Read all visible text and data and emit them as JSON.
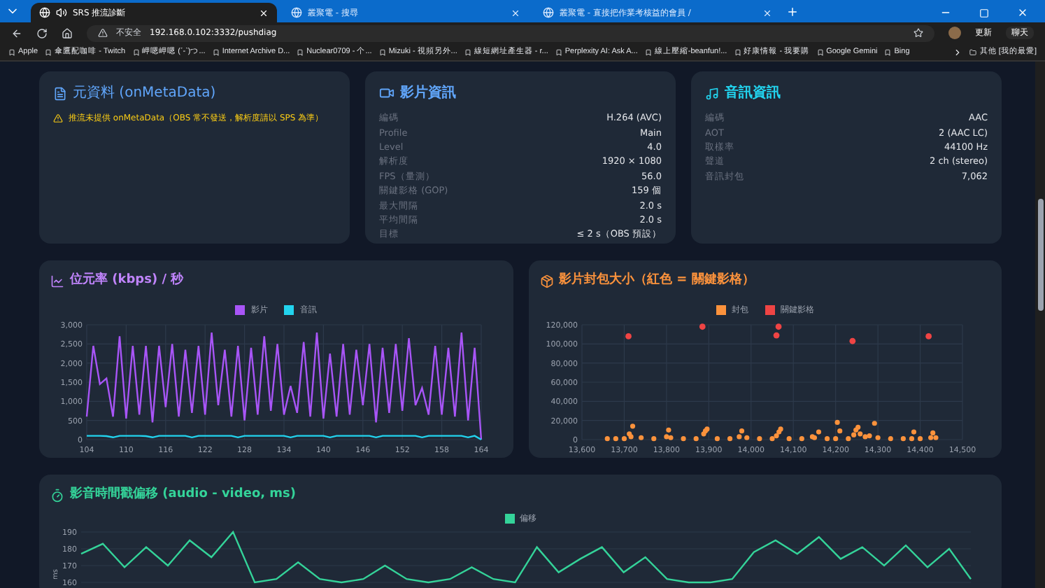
{
  "browser": {
    "tabs": [
      {
        "title": "SRS 推流診斷",
        "selected": true,
        "audio": true
      },
      {
        "title": "叢聚電 - 搜尋",
        "selected": false,
        "audio": false
      },
      {
        "title": "叢聚電 - 直接把作業考核益的會員 /",
        "selected": false,
        "audio": false
      }
    ],
    "address": {
      "security": "不安全",
      "url": "192.168.0.102:3332/pushdiag"
    },
    "update_button": "更新",
    "chat_button": "聊天",
    "bookmarks": [
      "Apple",
      "傘鷹配咖啡 - Twitch",
      "岬嗯岬嗯 (ˊ-ˋ)つ...",
      "Internet Archive D...",
      "Nuclear0709 - 个...",
      "Mizuki - 視頻另外...",
      "線短網址產生器 - r...",
      "Perplexity AI: Ask A...",
      "線上壓縮-beanfun!...",
      "好康情報 - 我要購",
      "Google Gemini",
      "Bing"
    ],
    "other_bookmarks": "其他 [我的最愛]"
  },
  "meta_card": {
    "title": "元資料 (onMetaData)",
    "warning": "推流未提供 onMetaData（OBS 常不發送，解析度請以 SPS 為準）"
  },
  "video_card": {
    "title": "影片資訊",
    "rows": [
      {
        "label": "編碼",
        "value": "H.264 (AVC)"
      },
      {
        "label": "Profile",
        "value": "Main"
      },
      {
        "label": "Level",
        "value": "4.0"
      },
      {
        "label": "解析度",
        "value": "1920 × 1080"
      },
      {
        "label": "FPS（量測）",
        "value": "56.0"
      },
      {
        "label": "關鍵影格 (GOP)",
        "value": "159 個"
      },
      {
        "label": "最大間隔",
        "value": "2.0 s"
      },
      {
        "label": "平均間隔",
        "value": "2.0 s"
      },
      {
        "label": "目標",
        "value": "≤ 2 s（OBS 預設）"
      }
    ]
  },
  "audio_card": {
    "title": "音訊資訊",
    "rows": [
      {
        "label": "編碼",
        "value": "AAC"
      },
      {
        "label": "AOT",
        "value": "2 (AAC LC)"
      },
      {
        "label": "取樣率",
        "value": "44100 Hz"
      },
      {
        "label": "聲道",
        "value": "2 ch (stereo)"
      },
      {
        "label": "音訊封包",
        "value": "7,062"
      }
    ]
  },
  "bitrate_card": {
    "title": "位元率 (kbps) / 秒",
    "chart_data": {
      "type": "line",
      "grid": true,
      "legend": "top",
      "x": [
        104,
        105,
        106,
        107,
        108,
        109,
        110,
        111,
        112,
        113,
        114,
        115,
        116,
        117,
        118,
        119,
        120,
        121,
        122,
        123,
        124,
        125,
        126,
        127,
        128,
        129,
        130,
        131,
        132,
        133,
        134,
        135,
        136,
        137,
        138,
        139,
        140,
        141,
        142,
        143,
        144,
        145,
        146,
        147,
        148,
        149,
        150,
        151,
        152,
        153,
        154,
        155,
        156,
        157,
        158,
        159,
        160,
        161,
        162,
        163,
        164
      ],
      "xlim": [
        104,
        164
      ],
      "ylim": [
        0,
        3000
      ],
      "xticks": [
        104,
        110,
        116,
        122,
        128,
        134,
        140,
        146,
        152,
        158,
        164
      ],
      "yticks": [
        0,
        500,
        {
          "value": 1000,
          "label": "1,000"
        },
        {
          "value": 1500,
          "label": "1,500"
        },
        {
          "value": 2000,
          "label": "2,000"
        },
        {
          "value": 2500,
          "label": "2,500"
        },
        {
          "value": 3000,
          "label": "3,000"
        }
      ],
      "series": [
        {
          "name": "影片",
          "color": "#a855f7",
          "values": [
            600,
            2450,
            1450,
            1600,
            600,
            2700,
            550,
            2450,
            650,
            2450,
            450,
            2450,
            850,
            2500,
            600,
            2350,
            700,
            2450,
            650,
            2800,
            900,
            2350,
            600,
            2450,
            500,
            2400,
            650,
            2700,
            750,
            2500,
            650,
            1400,
            700,
            2550,
            600,
            2800,
            550,
            2250,
            600,
            2500,
            650,
            2350,
            900,
            2500,
            450,
            2400,
            700,
            2500,
            750,
            2650,
            900,
            1350,
            650,
            2450,
            650,
            2400,
            600,
            2800,
            500,
            2400,
            0
          ]
        },
        {
          "name": "音訊",
          "color": "#22d3ee",
          "values": [
            100,
            100,
            100,
            90,
            60,
            100,
            100,
            100,
            100,
            90,
            60,
            100,
            100,
            100,
            100,
            100,
            60,
            100,
            100,
            100,
            100,
            100,
            100,
            60,
            100,
            100,
            100,
            100,
            100,
            100,
            100,
            60,
            100,
            100,
            100,
            100,
            100,
            60,
            100,
            100,
            100,
            100,
            100,
            100,
            60,
            100,
            100,
            100,
            100,
            100,
            100,
            60,
            100,
            100,
            100,
            100,
            100,
            100,
            60,
            100,
            0
          ]
        }
      ]
    }
  },
  "packet_card": {
    "title": "影片封包大小（紅色 = 關鍵影格）",
    "chart_data": {
      "type": "scatter",
      "grid": true,
      "legend": "top",
      "xlim": [
        13600,
        14500
      ],
      "ylim": [
        0,
        120000
      ],
      "xticks": [
        {
          "value": 13600,
          "label": "13,600"
        },
        {
          "value": 13700,
          "label": "13,700"
        },
        {
          "value": 13800,
          "label": "13,800"
        },
        {
          "value": 13900,
          "label": "13,900"
        },
        {
          "value": 14000,
          "label": "14,000"
        },
        {
          "value": 14100,
          "label": "14,100"
        },
        {
          "value": 14200,
          "label": "14,200"
        },
        {
          "value": 14300,
          "label": "14,300"
        },
        {
          "value": 14400,
          "label": "14,400"
        },
        {
          "value": 14500,
          "label": "14,500"
        }
      ],
      "yticks": [
        0,
        {
          "value": 20000,
          "label": "20,000"
        },
        {
          "value": 40000,
          "label": "40,000"
        },
        {
          "value": 60000,
          "label": "60,000"
        },
        {
          "value": 80000,
          "label": "80,000"
        },
        {
          "value": 100000,
          "label": "100,000"
        },
        {
          "value": 120000,
          "label": "120,000"
        }
      ],
      "series": [
        {
          "name": "封包",
          "color": "#fb923c",
          "x": [
            13660,
            13680,
            13700,
            13712,
            13716,
            13720,
            13740,
            13770,
            13800,
            13805,
            13810,
            13840,
            13870,
            13888,
            13892,
            13896,
            13920,
            13950,
            13972,
            13978,
            13990,
            14020,
            14050,
            14060,
            14066,
            14070,
            14090,
            14120,
            14145,
            14150,
            14160,
            14180,
            14200,
            14204,
            14210,
            14230,
            14243,
            14248,
            14253,
            14258,
            14270,
            14280,
            14292,
            14300,
            14330,
            14360,
            14380,
            14385,
            14400,
            14425,
            14430,
            14437
          ],
          "values": [
            1000,
            1000,
            1000,
            6000,
            3000,
            14000,
            2000,
            1000,
            3000,
            10000,
            2000,
            1000,
            1000,
            6000,
            9000,
            11000,
            1000,
            1000,
            3000,
            9000,
            2000,
            1000,
            1000,
            4000,
            8000,
            11000,
            1000,
            1000,
            3000,
            2000,
            8000,
            1000,
            1000,
            18000,
            9000,
            1000,
            5000,
            10000,
            13000,
            6000,
            3000,
            4000,
            17000,
            2000,
            1000,
            1000,
            1000,
            8000,
            1000,
            2000,
            7000,
            2000
          ]
        },
        {
          "name": "關鍵影格",
          "color": "#ef4444",
          "x": [
            13710,
            13885,
            14060,
            14065,
            14240,
            14420
          ],
          "values": [
            108000,
            118000,
            109000,
            118000,
            103000,
            108000
          ]
        }
      ]
    }
  },
  "offset_card": {
    "title": "影音時間戳偏移 (audio - video, ms)",
    "chart_data": {
      "type": "line",
      "grid": true,
      "legend": "top",
      "ylabel": "ms",
      "ylim": [
        160,
        190
      ],
      "yticks": [
        160,
        170,
        180,
        190
      ],
      "series": [
        {
          "name": "偏移",
          "color": "#34d399",
          "values": [
            177,
            183,
            169,
            181,
            170,
            185,
            175,
            190,
            160,
            162,
            172,
            162,
            160,
            162,
            170,
            162,
            160,
            162,
            169,
            162,
            160,
            181,
            166,
            174,
            181,
            166,
            175,
            162,
            160,
            160,
            162,
            178,
            185,
            177,
            187,
            174,
            181,
            170,
            182,
            169,
            180,
            162
          ]
        }
      ]
    }
  }
}
